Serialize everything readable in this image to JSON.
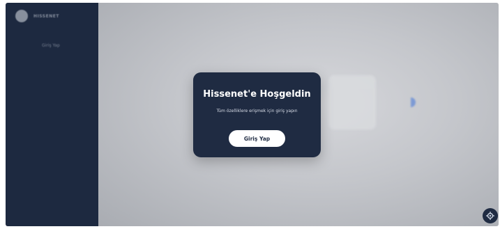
{
  "sidebar": {
    "brand_name": "HISSENET",
    "nav_item": "Giriş Yap"
  },
  "modal": {
    "title": "Hissenet'e Hoşgeldin",
    "subtitle": "Tüm özelliklere erişmek için giriş yapın",
    "login_button": "Giriş Yap"
  },
  "floating_button": {
    "icon": "settings-icon"
  },
  "colors": {
    "sidebar_bg": "#1d2940",
    "modal_bg": "#1f2b42",
    "button_bg": "#ffffff",
    "accent": "#6b8fd6"
  }
}
